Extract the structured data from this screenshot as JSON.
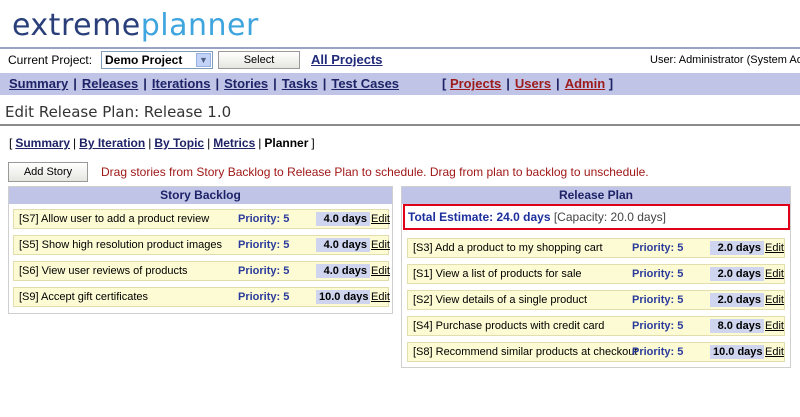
{
  "logo": {
    "part1": "extreme",
    "part2": "planner"
  },
  "project_bar": {
    "label": "Current Project:",
    "selected_project": "Demo Project",
    "select_button": "Select",
    "all_projects": "All Projects",
    "user": "User: Administrator (System Adm"
  },
  "nav": {
    "items": [
      "Summary",
      "Releases",
      "Iterations",
      "Stories",
      "Tasks",
      "Test Cases"
    ],
    "admin_items": [
      "Projects",
      "Users",
      "Admin"
    ]
  },
  "page_title": "Edit Release Plan: Release 1.0",
  "subtabs": {
    "links": [
      "Summary",
      "By Iteration",
      "By Topic",
      "Metrics"
    ],
    "current": "Planner"
  },
  "add_story_button": "Add Story",
  "hint": "Drag stories from Story Backlog to Release Plan to schedule. Drag from plan to backlog to unschedule.",
  "backlog": {
    "title": "Story Backlog",
    "stories": [
      {
        "title": "[S7] Allow user to add a product review",
        "priority": "Priority: 5",
        "days": "4.0 days",
        "edit": "Edit"
      },
      {
        "title": "[S5] Show high resolution product images",
        "priority": "Priority: 5",
        "days": "4.0 days",
        "edit": "Edit"
      },
      {
        "title": "[S6] View user reviews of products",
        "priority": "Priority: 5",
        "days": "4.0 days",
        "edit": "Edit"
      },
      {
        "title": "[S9] Accept gift certificates",
        "priority": "Priority: 5",
        "days": "10.0 days",
        "edit": "Edit"
      }
    ]
  },
  "release_plan": {
    "title": "Release Plan",
    "total_estimate": "Total Estimate: 24.0 days",
    "capacity": "[Capacity: 20.0 days]",
    "stories": [
      {
        "title": "[S3] Add a product to my shopping cart",
        "priority": "Priority: 5",
        "days": "2.0 days",
        "edit": "Edit"
      },
      {
        "title": "[S1] View a list of products for sale",
        "priority": "Priority: 5",
        "days": "2.0 days",
        "edit": "Edit"
      },
      {
        "title": "[S2] View details of a single product",
        "priority": "Priority: 5",
        "days": "2.0 days",
        "edit": "Edit"
      },
      {
        "title": "[S4] Purchase products with credit card",
        "priority": "Priority: 5",
        "days": "8.0 days",
        "edit": "Edit"
      },
      {
        "title": "[S8] Recommend similar products at checkout",
        "priority": "Priority: 5",
        "days": "10.0 days",
        "edit": "Edit"
      }
    ]
  },
  "colors": {
    "nav_background": "#c0c5e7",
    "story_background": "#fdfbd3",
    "highlight_border": "#e0001a",
    "hint_text": "#a01818"
  }
}
